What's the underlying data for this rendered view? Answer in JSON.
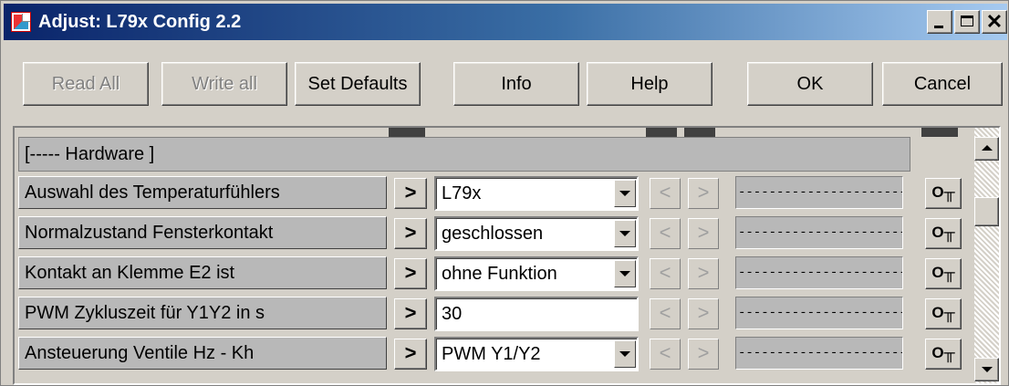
{
  "window": {
    "title": "Adjust: L79x Config 2.2",
    "controls": {
      "minimize": "_",
      "maximize": "□",
      "close": "✕"
    }
  },
  "toolbar": {
    "read_all": {
      "label": "Read All",
      "enabled": false
    },
    "write_all": {
      "label": "Write all",
      "enabled": false
    },
    "set_defaults": {
      "label": "Set Defaults",
      "enabled": true
    },
    "info": {
      "label": "Info",
      "enabled": true
    },
    "help": {
      "label": "Help",
      "enabled": true
    },
    "ok": {
      "label": "OK",
      "enabled": true
    },
    "cancel": {
      "label": "Cancel",
      "enabled": true
    }
  },
  "group": {
    "header": "[----- Hardware ]"
  },
  "rows": [
    {
      "label": "Auswahl des Temperaturfühlers",
      "go": ">",
      "value": "L79x",
      "dropdown": true,
      "prev": "<",
      "next": ">",
      "status": "------------------------------",
      "key": "O╥"
    },
    {
      "label": "Normalzustand Fensterkontakt",
      "go": ">",
      "value": "geschlossen",
      "dropdown": true,
      "prev": "<",
      "next": ">",
      "status": "------------------------------",
      "key": "O╥"
    },
    {
      "label": "Kontakt an Klemme E2 ist",
      "go": ">",
      "value": "ohne Funktion",
      "dropdown": true,
      "prev": "<",
      "next": ">",
      "status": "------------------------------",
      "key": "O╥"
    },
    {
      "label": "PWM Zykluszeit für Y1Y2 in s",
      "go": ">",
      "value": "30",
      "dropdown": false,
      "prev": "<",
      "next": ">",
      "status": "------------------------------",
      "key": "O╥"
    },
    {
      "label": "Ansteuerung Ventile Hz - Kh",
      "go": ">",
      "value": "PWM Y1/Y2",
      "dropdown": true,
      "prev": "<",
      "next": ">",
      "status": "------------------------------",
      "key": "O╥"
    }
  ],
  "icons": {
    "app": "app-icon",
    "go": "chevron-right-icon",
    "prev": "chevron-left-icon",
    "next": "chevron-right-icon",
    "dropdown": "dropdown-arrow-icon",
    "key": "key-icon",
    "scroll_up": "arrow-up-icon",
    "scroll_down": "arrow-down-icon"
  },
  "colors": {
    "titlebar_start": "#0a246a",
    "titlebar_end": "#a6caf0",
    "face": "#d4d0c8",
    "label_bg": "#b8b8b8"
  }
}
